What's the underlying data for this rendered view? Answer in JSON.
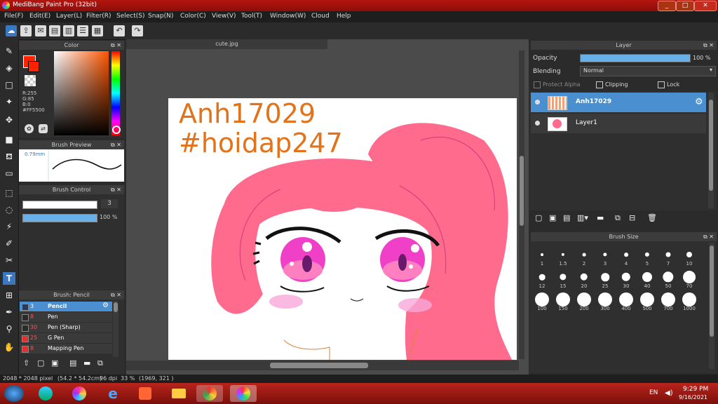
{
  "window": {
    "title": "MediBang Paint Pro (32bit)",
    "controls": [
      "_",
      "□",
      "✕"
    ]
  },
  "menu": [
    "File(F)",
    "Edit(E)",
    "Layer(L)",
    "Filter(R)",
    "Select(S)",
    "Snap(N)",
    "Color(C)",
    "View(V)",
    "Tool(T)",
    "Window(W)",
    "Cloud",
    "Help"
  ],
  "toolbar_icons": [
    "cloud-icon",
    "upload-icon",
    "chat-icon",
    "comment-icon",
    "document-icon",
    "list-icon",
    "grid-icon",
    "undo-icon",
    "redo-icon"
  ],
  "tools": [
    "brush-icon",
    "eraser-icon",
    "rect-icon",
    "dot-icon",
    "move-icon",
    "fill-rect-icon",
    "bucket-icon",
    "gradient-icon",
    "select-rect-icon",
    "lasso-icon",
    "magic-wand-icon",
    "select-pen-icon",
    "select-eraser-icon",
    "text-icon",
    "divide-icon",
    "eyedropper-icon",
    "hand-icon"
  ],
  "color_panel": {
    "title": "Color",
    "r": "R:255",
    "g": "G:85",
    "b": "B:0",
    "hex": "#FF5500",
    "foreground": "#ff2200",
    "background": "#ffffff"
  },
  "brush_preview": {
    "title": "Brush Preview",
    "size": "0.79mm"
  },
  "brush_control": {
    "title": "Brush Control",
    "size_value": "3",
    "opacity_value": "100 %",
    "opacity_fraction": 1.0
  },
  "brush_list": {
    "title": "Brush: Pencil",
    "items": [
      {
        "size": "3",
        "name": "Pencil",
        "color": "#2a3a5a",
        "selected": true
      },
      {
        "size": "8",
        "name": "Pen",
        "color": "#2a2a2a",
        "selected": false
      },
      {
        "size": "30",
        "name": "Pen (Sharp)",
        "color": "#2a2a2a",
        "selected": false
      },
      {
        "size": "25",
        "name": "G Pen",
        "color": "#e03030",
        "selected": false
      },
      {
        "size": "8",
        "name": "Mapping Pen",
        "color": "#e03030",
        "selected": false
      }
    ]
  },
  "document": {
    "tab": "cute.jpg",
    "watermark_line1": "Anh17029",
    "watermark_line2": "#hoidap247"
  },
  "layer_panel": {
    "title": "Layer",
    "opacity_label": "Opacity",
    "opacity_value": "100 %",
    "opacity_fraction": 1.0,
    "blending_label": "Blending",
    "blending_value": "Normal",
    "protect_alpha": "Protect Alpha",
    "clipping": "Clipping",
    "lock": "Lock",
    "layers": [
      {
        "name": "Anh17029",
        "selected": true
      },
      {
        "name": "Layer1",
        "selected": false
      }
    ]
  },
  "brush_size": {
    "title": "Brush Size",
    "sizes": [
      "1",
      "1.5",
      "2",
      "3",
      "4",
      "5",
      "7",
      "10",
      "12",
      "15",
      "20",
      "25",
      "30",
      "40",
      "50",
      "70",
      "100",
      "150",
      "200",
      "300",
      "400",
      "500",
      "700",
      "1000"
    ]
  },
  "status": {
    "dimensions": "2048 * 2048 pixel",
    "physical": "(54.2 * 54.2cm)",
    "dpi": "96 dpi",
    "zoom": "33 %",
    "coords": "(1969, 321 )"
  },
  "taskbar": {
    "lang": "EN",
    "time": "9:29 PM",
    "date": "9/16/2021"
  },
  "colors": {
    "accent": "#4a90d0",
    "titlebar": "#a3140e",
    "watermark": "#e3731a",
    "hair": "#ff6b8d"
  }
}
